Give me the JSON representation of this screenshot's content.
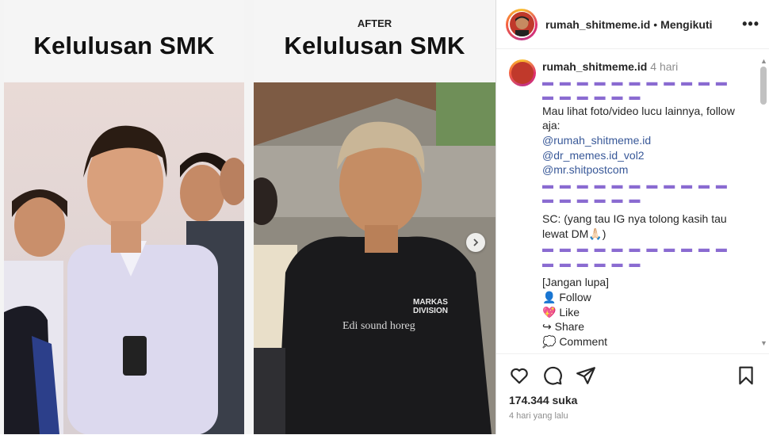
{
  "media": {
    "left_caption": "Kelulusan SMK",
    "right_small": "AFTER",
    "right_caption": "Kelulusan SMK",
    "overlay_text": "Edi sound horeg",
    "shirt_text": "MARKAS DIVISION"
  },
  "header": {
    "username": "rumah_shitmeme.id",
    "separator": "•",
    "follow_label": "Mengikuti",
    "more": "•••"
  },
  "caption": {
    "username": "rumah_shitmeme.id",
    "time": "4 hari",
    "dashes": "▬ ▬ ▬ ▬ ▬ ▬ ▬ ▬ ▬ ▬ ▬ ▬ ▬ ▬ ▬ ▬ ▬",
    "line1": "Mau lihat foto/video lucu lainnya, follow aja:",
    "mention1": "@rumah_shitmeme.id",
    "mention2": "@dr_memes.id_vol2",
    "mention3": "@mr.shitpostcom",
    "line2": "SC: (yang tau IG nya tolong kasih tau lewat DM🙏🏻)",
    "line3": "[Jangan lupa]",
    "follow": "👤 Follow",
    "like": "💖 Like",
    "share": "↪ Share",
    "comment": "💭 Comment"
  },
  "footer": {
    "likes": "174.344 suka",
    "ago": "4 hari yang lalu"
  },
  "colors": {
    "accent_dash": "#8a6bd1",
    "mention": "#385898"
  },
  "icons": [
    "heart-icon",
    "comment-icon",
    "share-icon",
    "bookmark-icon",
    "chevron-right-icon"
  ]
}
